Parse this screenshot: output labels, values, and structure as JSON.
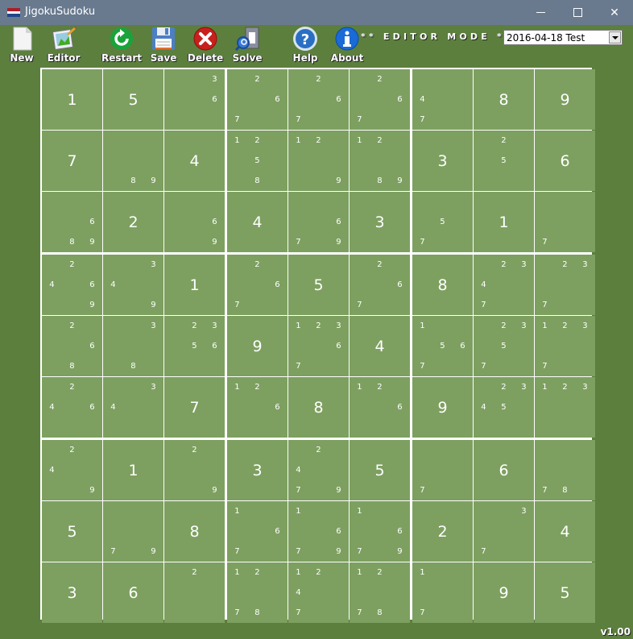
{
  "window": {
    "title": "JigokuSudoku",
    "flag_colors": [
      "#ae1c28",
      "#ffffff",
      "#21468b"
    ]
  },
  "toolbar": {
    "buttons": [
      {
        "id": "new",
        "label": "New",
        "icon": "new-file-icon"
      },
      {
        "id": "editor",
        "label": "Editor",
        "icon": "editor-picture-icon"
      },
      {
        "id": "restart",
        "label": "Restart",
        "icon": "restart-icon"
      },
      {
        "id": "save",
        "label": "Save",
        "icon": "floppy-disk-icon"
      },
      {
        "id": "delete",
        "label": "Delete",
        "icon": "delete-x-icon"
      },
      {
        "id": "solve",
        "label": "Solve",
        "icon": "solve-magnifier-icon"
      },
      {
        "id": "help",
        "label": "Help",
        "icon": "help-question-icon"
      },
      {
        "id": "about",
        "label": "About",
        "icon": "about-info-icon"
      }
    ],
    "mode_label": "** EDITOR MODE **",
    "puzzle_select": {
      "value": "2016-04-18 Test"
    }
  },
  "board": {
    "cells": [
      [
        {
          "v": 1
        },
        {
          "v": 5
        },
        {
          "c": [
            3,
            6
          ]
        },
        {
          "c": [
            2,
            6,
            7
          ]
        },
        {
          "c": [
            2,
            6,
            7
          ]
        },
        {
          "c": [
            2,
            6,
            7
          ]
        },
        {
          "c": [
            4,
            7
          ]
        },
        {
          "v": 8
        },
        {
          "v": 9
        }
      ],
      [
        {
          "v": 7
        },
        {
          "c": [
            8,
            9
          ]
        },
        {
          "v": 4
        },
        {
          "c": [
            1,
            2,
            5,
            8
          ]
        },
        {
          "c": [
            1,
            2,
            9
          ]
        },
        {
          "c": [
            1,
            2,
            8,
            9
          ]
        },
        {
          "v": 3
        },
        {
          "c": [
            2,
            5
          ]
        },
        {
          "v": 6
        }
      ],
      [
        {
          "c": [
            6,
            8,
            9
          ]
        },
        {
          "v": 2
        },
        {
          "c": [
            6,
            9
          ]
        },
        {
          "v": 4
        },
        {
          "c": [
            6,
            7,
            9
          ]
        },
        {
          "v": 3
        },
        {
          "c": [
            5,
            7
          ]
        },
        {
          "v": 1
        },
        {
          "c": [
            7
          ]
        }
      ],
      [
        {
          "c": [
            2,
            4,
            6,
            9
          ]
        },
        {
          "c": [
            3,
            4,
            9
          ]
        },
        {
          "v": 1
        },
        {
          "c": [
            2,
            6,
            7
          ]
        },
        {
          "v": 5
        },
        {
          "c": [
            2,
            6,
            7
          ]
        },
        {
          "v": 8
        },
        {
          "c": [
            2,
            3,
            4,
            7
          ]
        },
        {
          "c": [
            2,
            3,
            7
          ]
        }
      ],
      [
        {
          "c": [
            2,
            6,
            8
          ]
        },
        {
          "c": [
            3,
            8
          ]
        },
        {
          "c": [
            2,
            3,
            5,
            6
          ]
        },
        {
          "v": 9
        },
        {
          "c": [
            1,
            2,
            3,
            6,
            7
          ]
        },
        {
          "v": 4
        },
        {
          "c": [
            1,
            5,
            6,
            7
          ]
        },
        {
          "c": [
            2,
            3,
            5,
            7
          ]
        },
        {
          "c": [
            1,
            2,
            3,
            7
          ]
        }
      ],
      [
        {
          "c": [
            2,
            4,
            6
          ]
        },
        {
          "c": [
            3,
            4
          ]
        },
        {
          "v": 7
        },
        {
          "c": [
            1,
            2,
            6
          ]
        },
        {
          "v": 8
        },
        {
          "c": [
            1,
            2,
            6
          ]
        },
        {
          "v": 9
        },
        {
          "c": [
            2,
            3,
            4,
            5
          ]
        },
        {
          "c": [
            1,
            2,
            3
          ]
        }
      ],
      [
        {
          "c": [
            2,
            4,
            9
          ]
        },
        {
          "v": 1
        },
        {
          "c": [
            2,
            9
          ]
        },
        {
          "v": 3
        },
        {
          "c": [
            2,
            4,
            7,
            9
          ]
        },
        {
          "v": 5
        },
        {
          "c": [
            7
          ]
        },
        {
          "v": 6
        },
        {
          "c": [
            7,
            8
          ]
        }
      ],
      [
        {
          "v": 5
        },
        {
          "c": [
            7,
            9
          ]
        },
        {
          "v": 8
        },
        {
          "c": [
            1,
            6,
            7
          ]
        },
        {
          "c": [
            1,
            6,
            7,
            9
          ]
        },
        {
          "c": [
            1,
            6,
            7,
            9
          ]
        },
        {
          "v": 2
        },
        {
          "c": [
            3,
            7
          ]
        },
        {
          "v": 4
        }
      ],
      [
        {
          "v": 3
        },
        {
          "v": 6
        },
        {
          "c": [
            2
          ]
        },
        {
          "c": [
            1,
            2,
            7,
            8
          ]
        },
        {
          "c": [
            1,
            2,
            4,
            7
          ]
        },
        {
          "c": [
            1,
            2,
            7,
            8
          ]
        },
        {
          "c": [
            1,
            7
          ]
        },
        {
          "v": 9
        },
        {
          "v": 5
        }
      ]
    ]
  },
  "version": "v1.00"
}
